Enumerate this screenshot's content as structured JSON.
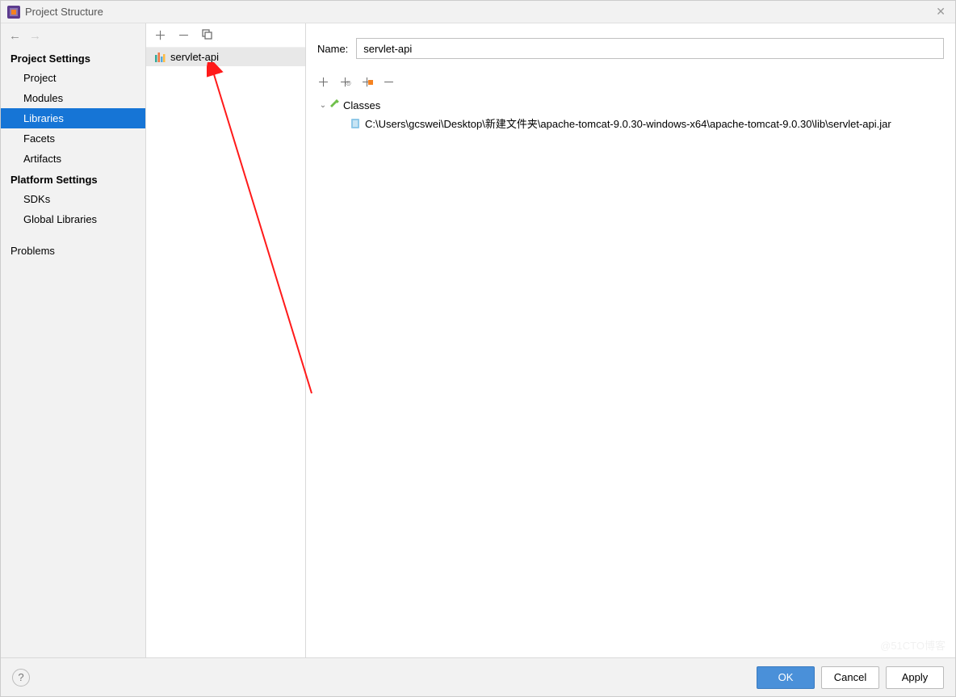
{
  "window": {
    "title": "Project Structure"
  },
  "sidebar": {
    "project_settings_label": "Project Settings",
    "platform_settings_label": "Platform Settings",
    "project_settings": [
      "Project",
      "Modules",
      "Libraries",
      "Facets",
      "Artifacts"
    ],
    "platform_settings": [
      "SDKs",
      "Global Libraries"
    ],
    "problems_label": "Problems"
  },
  "library_list": {
    "items": [
      {
        "name": "servlet-api"
      }
    ]
  },
  "details": {
    "name_label": "Name:",
    "name_value": "servlet-api",
    "tree": {
      "root_label": "Classes",
      "jar_path": "C:\\Users\\gcswei\\Desktop\\新建文件夹\\apache-tomcat-9.0.30-windows-x64\\apache-tomcat-9.0.30\\lib\\servlet-api.jar"
    }
  },
  "footer": {
    "ok": "OK",
    "cancel": "Cancel",
    "apply": "Apply"
  },
  "watermark": "@51CTO博客"
}
